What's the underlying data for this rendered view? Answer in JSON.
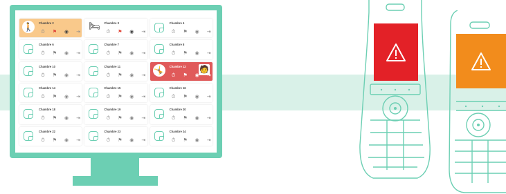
{
  "colors": {
    "accent": "#6ccfb3",
    "band": "#d9f1e8",
    "alert_red": "#e32127",
    "alert_orange": "#f28c1c",
    "card_orange": "#f9c98b",
    "card_red": "#e05a5a"
  },
  "rooms": [
    {
      "label": "Chambre 2",
      "state": "orange",
      "badge": "walking-person-icon"
    },
    {
      "label": "Chambre 3",
      "state": "bed",
      "badge": "person-in-bed-icon"
    },
    {
      "label": "Chambre 4",
      "state": "normal"
    },
    {
      "label": "Chambre 6",
      "state": "normal"
    },
    {
      "label": "Chambre 7",
      "state": "normal"
    },
    {
      "label": "Chambre 8",
      "state": "normal"
    },
    {
      "label": "Chambre 10",
      "state": "normal"
    },
    {
      "label": "Chambre 11",
      "state": "normal"
    },
    {
      "label": "Chambre 12",
      "state": "red",
      "badge": "fall-person-icon"
    },
    {
      "label": "Chambre 14",
      "state": "normal"
    },
    {
      "label": "Chambre 15",
      "state": "normal"
    },
    {
      "label": "Chambre 16",
      "state": "normal"
    },
    {
      "label": "Chambre 18",
      "state": "normal"
    },
    {
      "label": "Chambre 19",
      "state": "normal"
    },
    {
      "label": "Chambre 20",
      "state": "normal"
    },
    {
      "label": "Chambre 22",
      "state": "normal"
    },
    {
      "label": "Chambre 23",
      "state": "normal"
    },
    {
      "label": "Chambre 24",
      "state": "normal"
    }
  ],
  "actions": [
    "timer-icon",
    "flag-icon",
    "eye-icon",
    "exit-icon"
  ]
}
